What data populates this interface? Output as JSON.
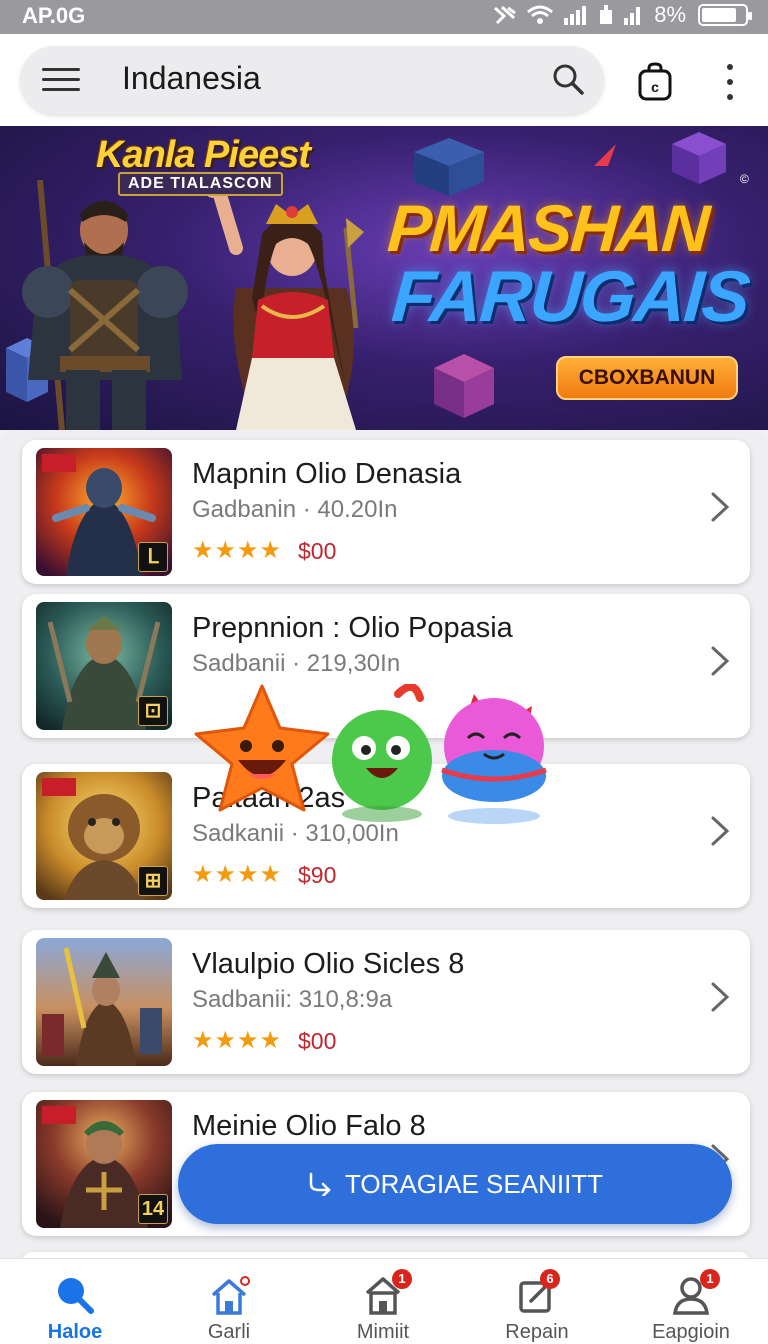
{
  "status_bar": {
    "carrier": "AP.0G",
    "battery": "8%",
    "battery_level": 0.82
  },
  "app_bar": {
    "title": "Indanesia"
  },
  "banner": {
    "brand": "Kanla Pieest",
    "brand_sub": "ADE TIALASCON",
    "headline_1": "PMASHAN",
    "headline_2": "FARUGAIS",
    "cta": "CBOXBANUN",
    "mark": "©"
  },
  "games": [
    {
      "name": "Mapnin Olio Denasia",
      "meta": "Gadbanin · 40.20In",
      "stars": "★★★★",
      "price": "$00",
      "badge": "ᒪ"
    },
    {
      "name": "Prepnnion : Olio Popasia",
      "meta": "Sadbanii · 219,30In",
      "stars": "",
      "price": "",
      "badge": "⊡"
    },
    {
      "name": "Paltaan 2as",
      "meta": "Sadkanii · 310,00In",
      "stars": "★★★★",
      "price": "$90",
      "badge": "⊞"
    },
    {
      "name": "Vlaulpio Olio Sicles 8",
      "meta": "Sadbanii: 310,8:9a",
      "stars": "★★★★",
      "price": "$00",
      "badge": ""
    },
    {
      "name": "Meinie Olio Falo 8",
      "meta": "",
      "stars": "",
      "price": "",
      "badge": "14"
    }
  ],
  "fab": {
    "label": "TORAGIAE SEANIITT"
  },
  "bottom_nav": [
    {
      "label": "Haloe",
      "badge": ""
    },
    {
      "label": "Garli",
      "badge": ""
    },
    {
      "label": "Mimiit",
      "badge": "1"
    },
    {
      "label": "Repain",
      "badge": "6"
    },
    {
      "label": "Eapgioin",
      "badge": "1"
    }
  ]
}
